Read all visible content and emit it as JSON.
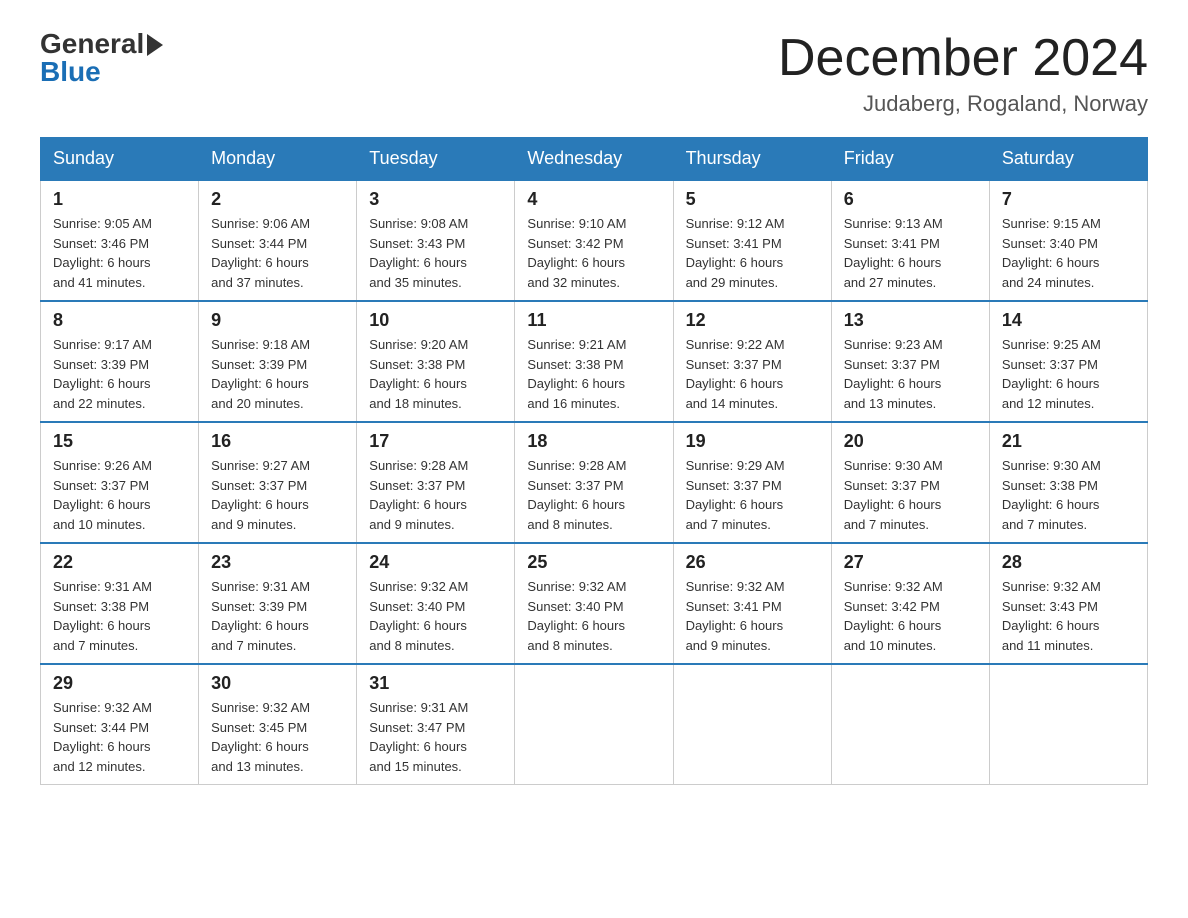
{
  "logo": {
    "general": "General",
    "blue": "Blue"
  },
  "header": {
    "month_year": "December 2024",
    "location": "Judaberg, Rogaland, Norway"
  },
  "weekdays": [
    "Sunday",
    "Monday",
    "Tuesday",
    "Wednesday",
    "Thursday",
    "Friday",
    "Saturday"
  ],
  "weeks": [
    [
      {
        "day": "1",
        "sunrise": "9:05 AM",
        "sunset": "3:46 PM",
        "daylight": "6 hours and 41 minutes."
      },
      {
        "day": "2",
        "sunrise": "9:06 AM",
        "sunset": "3:44 PM",
        "daylight": "6 hours and 37 minutes."
      },
      {
        "day": "3",
        "sunrise": "9:08 AM",
        "sunset": "3:43 PM",
        "daylight": "6 hours and 35 minutes."
      },
      {
        "day": "4",
        "sunrise": "9:10 AM",
        "sunset": "3:42 PM",
        "daylight": "6 hours and 32 minutes."
      },
      {
        "day": "5",
        "sunrise": "9:12 AM",
        "sunset": "3:41 PM",
        "daylight": "6 hours and 29 minutes."
      },
      {
        "day": "6",
        "sunrise": "9:13 AM",
        "sunset": "3:41 PM",
        "daylight": "6 hours and 27 minutes."
      },
      {
        "day": "7",
        "sunrise": "9:15 AM",
        "sunset": "3:40 PM",
        "daylight": "6 hours and 24 minutes."
      }
    ],
    [
      {
        "day": "8",
        "sunrise": "9:17 AM",
        "sunset": "3:39 PM",
        "daylight": "6 hours and 22 minutes."
      },
      {
        "day": "9",
        "sunrise": "9:18 AM",
        "sunset": "3:39 PM",
        "daylight": "6 hours and 20 minutes."
      },
      {
        "day": "10",
        "sunrise": "9:20 AM",
        "sunset": "3:38 PM",
        "daylight": "6 hours and 18 minutes."
      },
      {
        "day": "11",
        "sunrise": "9:21 AM",
        "sunset": "3:38 PM",
        "daylight": "6 hours and 16 minutes."
      },
      {
        "day": "12",
        "sunrise": "9:22 AM",
        "sunset": "3:37 PM",
        "daylight": "6 hours and 14 minutes."
      },
      {
        "day": "13",
        "sunrise": "9:23 AM",
        "sunset": "3:37 PM",
        "daylight": "6 hours and 13 minutes."
      },
      {
        "day": "14",
        "sunrise": "9:25 AM",
        "sunset": "3:37 PM",
        "daylight": "6 hours and 12 minutes."
      }
    ],
    [
      {
        "day": "15",
        "sunrise": "9:26 AM",
        "sunset": "3:37 PM",
        "daylight": "6 hours and 10 minutes."
      },
      {
        "day": "16",
        "sunrise": "9:27 AM",
        "sunset": "3:37 PM",
        "daylight": "6 hours and 9 minutes."
      },
      {
        "day": "17",
        "sunrise": "9:28 AM",
        "sunset": "3:37 PM",
        "daylight": "6 hours and 9 minutes."
      },
      {
        "day": "18",
        "sunrise": "9:28 AM",
        "sunset": "3:37 PM",
        "daylight": "6 hours and 8 minutes."
      },
      {
        "day": "19",
        "sunrise": "9:29 AM",
        "sunset": "3:37 PM",
        "daylight": "6 hours and 7 minutes."
      },
      {
        "day": "20",
        "sunrise": "9:30 AM",
        "sunset": "3:37 PM",
        "daylight": "6 hours and 7 minutes."
      },
      {
        "day": "21",
        "sunrise": "9:30 AM",
        "sunset": "3:38 PM",
        "daylight": "6 hours and 7 minutes."
      }
    ],
    [
      {
        "day": "22",
        "sunrise": "9:31 AM",
        "sunset": "3:38 PM",
        "daylight": "6 hours and 7 minutes."
      },
      {
        "day": "23",
        "sunrise": "9:31 AM",
        "sunset": "3:39 PM",
        "daylight": "6 hours and 7 minutes."
      },
      {
        "day": "24",
        "sunrise": "9:32 AM",
        "sunset": "3:40 PM",
        "daylight": "6 hours and 8 minutes."
      },
      {
        "day": "25",
        "sunrise": "9:32 AM",
        "sunset": "3:40 PM",
        "daylight": "6 hours and 8 minutes."
      },
      {
        "day": "26",
        "sunrise": "9:32 AM",
        "sunset": "3:41 PM",
        "daylight": "6 hours and 9 minutes."
      },
      {
        "day": "27",
        "sunrise": "9:32 AM",
        "sunset": "3:42 PM",
        "daylight": "6 hours and 10 minutes."
      },
      {
        "day": "28",
        "sunrise": "9:32 AM",
        "sunset": "3:43 PM",
        "daylight": "6 hours and 11 minutes."
      }
    ],
    [
      {
        "day": "29",
        "sunrise": "9:32 AM",
        "sunset": "3:44 PM",
        "daylight": "6 hours and 12 minutes."
      },
      {
        "day": "30",
        "sunrise": "9:32 AM",
        "sunset": "3:45 PM",
        "daylight": "6 hours and 13 minutes."
      },
      {
        "day": "31",
        "sunrise": "9:31 AM",
        "sunset": "3:47 PM",
        "daylight": "6 hours and 15 minutes."
      },
      null,
      null,
      null,
      null
    ]
  ],
  "labels": {
    "sunrise": "Sunrise:",
    "sunset": "Sunset:",
    "daylight": "Daylight:"
  }
}
